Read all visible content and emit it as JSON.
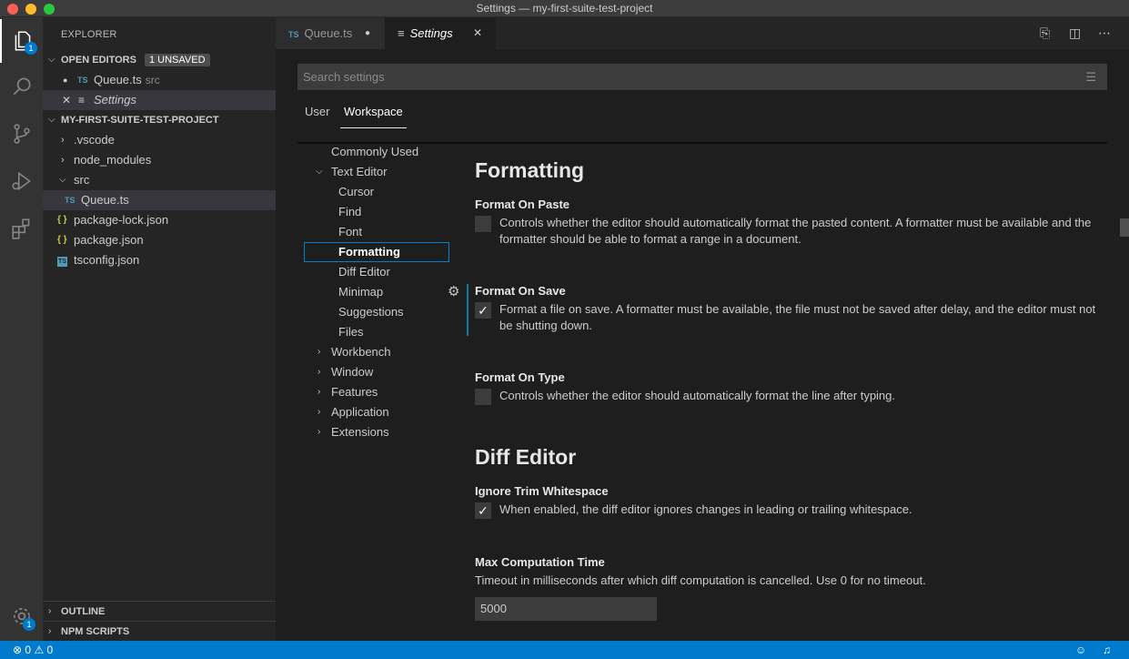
{
  "window": {
    "title": "Settings — my-first-suite-test-project"
  },
  "activity": {
    "explorer_badge": "1",
    "settings_badge": "1"
  },
  "sidebar": {
    "title": "EXPLORER",
    "open_editors": {
      "title": "OPEN EDITORS",
      "badge": "1 UNSAVED",
      "items": [
        {
          "icon": "TS",
          "name": "Queue.ts",
          "sub": "src"
        },
        {
          "name": "Settings"
        }
      ]
    },
    "project": {
      "title": "MY-FIRST-SUITE-TEST-PROJECT",
      "items": [
        {
          "name": ".vscode"
        },
        {
          "name": "node_modules"
        },
        {
          "name": "src"
        },
        {
          "icon": "TS",
          "name": "Queue.ts"
        },
        {
          "icon": "{ }",
          "name": "package-lock.json"
        },
        {
          "icon": "{ }",
          "name": "package.json"
        },
        {
          "icon": "TS",
          "name": "tsconfig.json"
        }
      ]
    },
    "outline": "OUTLINE",
    "npm_scripts": "NPM SCRIPTS"
  },
  "tabs": [
    {
      "icon": "TS",
      "label": "Queue.ts",
      "dirty": "●"
    },
    {
      "label": "Settings",
      "close": "✕"
    }
  ],
  "settings": {
    "search_placeholder": "Search settings",
    "scopes": [
      "User",
      "Workspace"
    ],
    "toc": [
      "Commonly Used",
      "Text Editor",
      "Cursor",
      "Find",
      "Font",
      "Formatting",
      "Diff Editor",
      "Minimap",
      "Suggestions",
      "Files",
      "Workbench",
      "Window",
      "Features",
      "Application",
      "Extensions"
    ],
    "groups": {
      "formatting": "Formatting",
      "diff_editor": "Diff Editor"
    },
    "items": [
      {
        "title": "Format On Paste",
        "desc": "Controls whether the editor should automatically format the pasted content. A formatter must be available and the formatter should be able to format a range in a document.",
        "checked": false
      },
      {
        "title": "Format On Save",
        "desc": "Format a file on save. A formatter must be available, the file must not be saved after delay, and the editor must not be shutting down.",
        "checked": true
      },
      {
        "title": "Format On Type",
        "desc": "Controls whether the editor should automatically format the line after typing.",
        "checked": false
      },
      {
        "title": "Ignore Trim Whitespace",
        "desc": "When enabled, the diff editor ignores changes in leading or trailing whitespace.",
        "checked": true
      },
      {
        "title": "Max Computation Time",
        "desc": "Timeout in milliseconds after which diff computation is cancelled. Use 0 for no timeout.",
        "value": "5000"
      }
    ],
    "check_glyph": "✓"
  },
  "status": {
    "errors": "0",
    "warnings": "0"
  },
  "colors": {
    "accent": "#007acc",
    "modified": "#0c7d9d"
  }
}
